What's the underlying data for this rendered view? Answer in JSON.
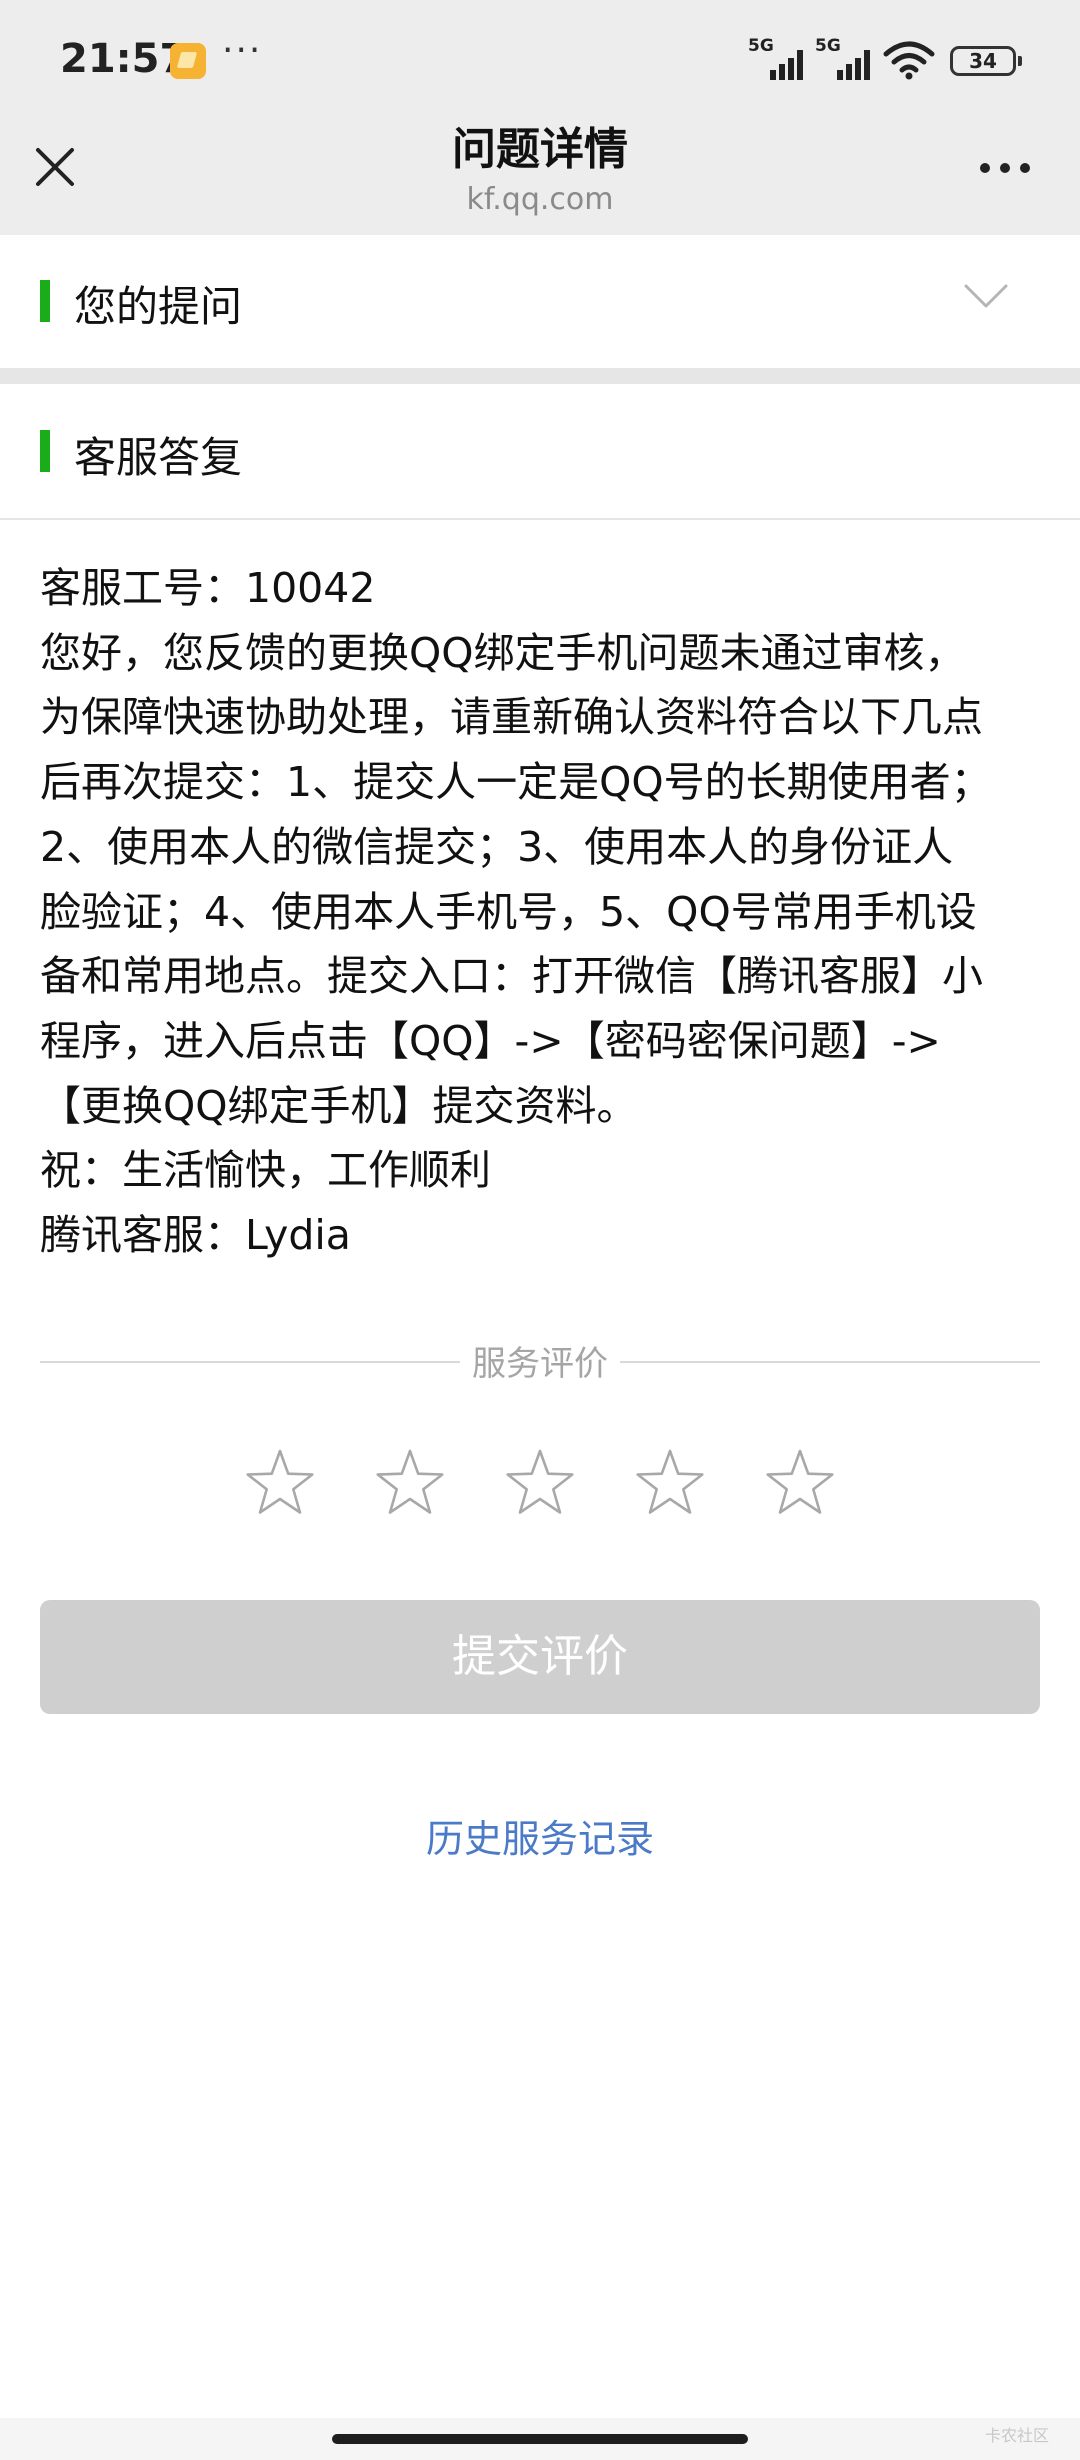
{
  "status_bar": {
    "time": "21:57",
    "overflow": "···",
    "network_1": "5G",
    "network_2": "5G",
    "battery": "34",
    "icons": [
      "app-notification-icon",
      "signal-icon",
      "signal-icon",
      "wifi-icon",
      "battery-icon"
    ]
  },
  "nav": {
    "title": "问题详情",
    "subtitle": "kf.qq.com",
    "close_icon": "close-icon",
    "more_icon": "more-icon"
  },
  "question_section": {
    "label": "您的提问",
    "toggle_icon": "chevron-down-icon"
  },
  "reply_section": {
    "label": "客服答复",
    "lines": [
      "客服工号：10042",
      "您好，您反馈的更换QQ绑定手机问题未通过审核，",
      "为保障快速协助处理，请重新确认资料符合以下几点",
      "后再次提交：1、提交人一定是QQ号的长期使用者；",
      "2、使用本人的微信提交；3、使用本人的身份证人",
      "脸验证；4、使用本人手机号，5、QQ号常用手机设",
      "备和常用地点。提交入口：打开微信【腾讯客服】小",
      "程序，进入后点击【QQ】->【密码密保问题】->",
      "【更换QQ绑定手机】提交资料。",
      "祝：生活愉快，工作顺利",
      "腾讯客服：Lydia"
    ]
  },
  "rating": {
    "label": "服务评价",
    "max_stars": 5,
    "selected_stars": 0,
    "submit_label": "提交评价"
  },
  "history_link": "历史服务记录",
  "watermark": "卡农社区",
  "colors": {
    "accent_green": "#1aad19",
    "link_blue": "#4a7ac8",
    "header_bg": "#ededed",
    "disabled_button": "#cfcfcf"
  }
}
